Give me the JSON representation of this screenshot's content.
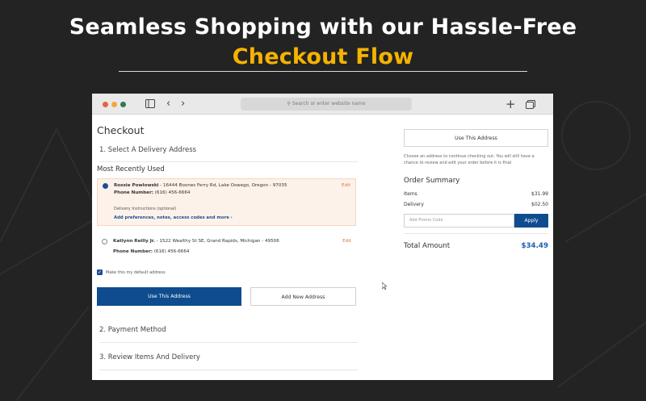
{
  "hero": {
    "line1": "Seamless Shopping with our Hassle-Free",
    "line2": "Checkout Flow",
    "accent_color": "#f5b301"
  },
  "browser": {
    "address_placeholder": "Search or enter website name",
    "icons": [
      "sidebar-icon",
      "back-arrow-icon",
      "forward-arrow-icon",
      "plus-icon",
      "tabs-icon",
      "search-icon"
    ],
    "dot_colors": [
      "#e8623f",
      "#f1a93d",
      "#2f7a52"
    ]
  },
  "checkout": {
    "title": "Checkout",
    "step1": "1. Select A Delivery Address",
    "most_recent": "Most Recently Used",
    "addresses": [
      {
        "name": "Rossie Powlowski",
        "address": " - 16444 Boones Ferry Rd, Lake Oswego, Oregon - 97035",
        "phone_label": "Phone Number:",
        "phone": " (616) 456-6664",
        "edit": "Edit",
        "instructions": "Delivery Instructions (optional)",
        "add_link": "Add preferences, notes, access codes and more",
        "selected": true
      },
      {
        "name": "Katlynn Reilly Jr.",
        "address": " - 1522 Wealthy St SE, Grand Rapids, Michigan - 49506",
        "phone_label": "Phone Number:",
        "phone": " (616) 456-6664",
        "edit": "Edit",
        "selected": false
      }
    ],
    "default_checkbox": "Make this my default address",
    "use_address_btn": "Use This Address",
    "add_address_btn": "Add New Address",
    "step2": "2. Payment Method",
    "step3": "3. Review Items And Delivery"
  },
  "summary": {
    "use_address_btn": "Use This Address",
    "note": "Choose an address to continue checking out. You will still have a chance to review and edit your order before it is final",
    "title": "Order Summary",
    "items_label": "Items",
    "items_value": "$31.99",
    "delivery_label": "Delivery",
    "delivery_value": "$02.50",
    "promo_placeholder": "Add Promo Code",
    "apply_btn": "Apply",
    "total_label": "Total Amount",
    "total_value": "$34.49",
    "total_color": "#1c5fae",
    "primary_color": "#0f4c8f"
  }
}
